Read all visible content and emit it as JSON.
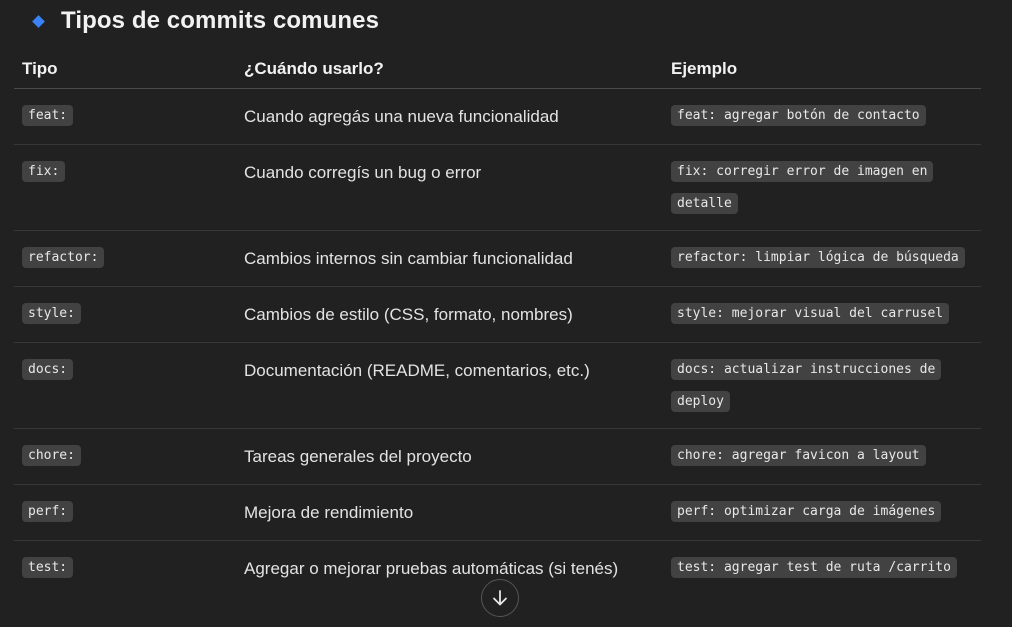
{
  "section": {
    "title": "Tipos de commits comunes"
  },
  "table": {
    "headers": [
      "Tipo",
      "¿Cuándo usarlo?",
      "Ejemplo"
    ],
    "rows": [
      {
        "type": "feat:",
        "when": "Cuando agregás una nueva funcionalidad",
        "example": "feat: agregar botón de contacto"
      },
      {
        "type": "fix:",
        "when": "Cuando corregís un bug o error",
        "example": "fix: corregir error de imagen en detalle"
      },
      {
        "type": "refactor:",
        "when": "Cambios internos sin cambiar funcionalidad",
        "example": "refactor: limpiar lógica de búsqueda"
      },
      {
        "type": "style:",
        "when": "Cambios de estilo (CSS, formato, nombres)",
        "example": "style: mejorar visual del carrusel"
      },
      {
        "type": "docs:",
        "when": "Documentación (README, comentarios, etc.)",
        "example": "docs: actualizar instrucciones de deploy"
      },
      {
        "type": "chore:",
        "when": "Tareas generales del proyecto",
        "example": "chore: agregar favicon a layout"
      },
      {
        "type": "perf:",
        "when": "Mejora de rendimiento",
        "example": "perf: optimizar carga de imágenes"
      },
      {
        "type": "test:",
        "when": "Agregar o mejorar pruebas automáticas (si tenés)",
        "example": "test: agregar test de ruta /carrito"
      }
    ]
  },
  "icons": {
    "bullet": "diamond-icon",
    "scroll": "arrow-down-icon"
  },
  "colors": {
    "background": "#212121",
    "bullet": "#3b82f6",
    "code_bg": "#424242"
  }
}
